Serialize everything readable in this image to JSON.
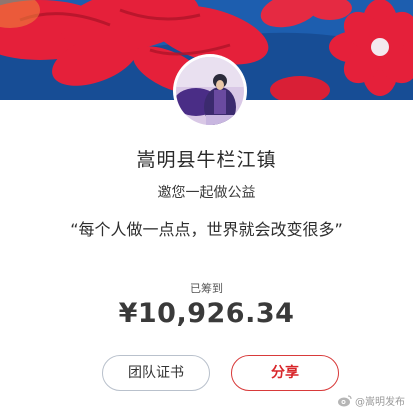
{
  "header": {
    "banner_colors": [
      "#1e5fb0",
      "#e8223a",
      "#c61a2e",
      "#f05a6a"
    ]
  },
  "profile": {
    "title": "嵩明县牛栏江镇",
    "subtitle": "邀您一起做公益",
    "slogan": "“每个人做一点点，世界就会改变很多”"
  },
  "fundraising": {
    "raised_label": "已筹到",
    "amount": "¥10,926.34"
  },
  "actions": {
    "certificate_label": "团队证书",
    "share_label": "分享"
  },
  "watermark": {
    "text": "@嵩明发布",
    "icon": "weibo-icon"
  }
}
